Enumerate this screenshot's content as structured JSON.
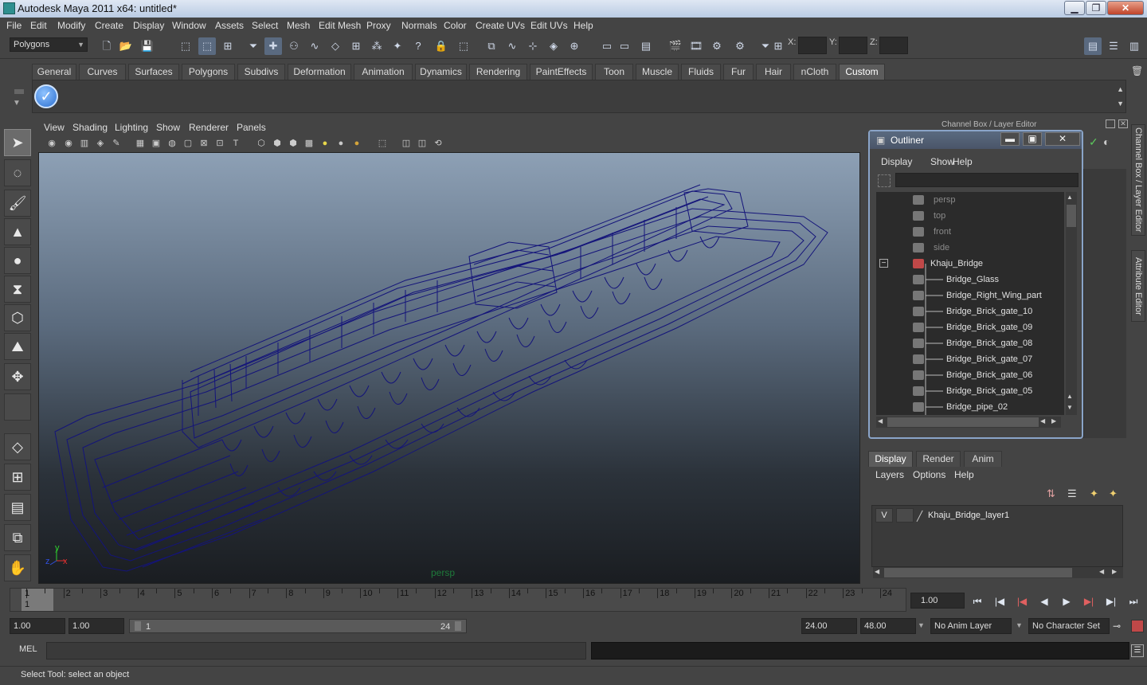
{
  "window": {
    "title": "Autodesk Maya 2011 x64: untitled*",
    "min": "▁",
    "max": "❐",
    "close": "✕"
  },
  "menubar": [
    "File",
    "Edit",
    "Modify",
    "Create",
    "Display",
    "Window",
    "Assets",
    "Select",
    "Mesh",
    "Edit Mesh",
    "Proxy",
    "Normals",
    "Color",
    "Create UVs",
    "Edit UVs",
    "Help"
  ],
  "statusline": {
    "menuset": "Polygons",
    "x_label": "X:",
    "y_label": "Y:",
    "z_label": "Z:"
  },
  "shelf": {
    "tabs": [
      "General",
      "Curves",
      "Surfaces",
      "Polygons",
      "Subdivs",
      "Deformation",
      "Animation",
      "Dynamics",
      "Rendering",
      "PaintEffects",
      "Toon",
      "Muscle",
      "Fluids",
      "Fur",
      "Hair",
      "nCloth",
      "Custom"
    ],
    "active_tab": "Custom",
    "icon_glyph": "✓"
  },
  "viewport": {
    "menu": [
      "View",
      "Shading",
      "Lighting",
      "Show",
      "Renderer",
      "Panels"
    ],
    "camera": "persp",
    "axis_x": "x",
    "axis_y": "y",
    "axis_z": "z"
  },
  "channelbox": {
    "header": "Channel Box / Layer Editor",
    "side_tab_1": "Channel Box / Layer Editor",
    "side_tab_2": "Attribute Editor"
  },
  "outliner": {
    "title": "Outliner",
    "menu": [
      "Display",
      "Show",
      "Help"
    ],
    "btn_min": "▬",
    "btn_max": "▣",
    "btn_close": "✕",
    "items": [
      {
        "label": "persp",
        "kind": "cam"
      },
      {
        "label": "top",
        "kind": "cam"
      },
      {
        "label": "front",
        "kind": "cam"
      },
      {
        "label": "side",
        "kind": "cam"
      },
      {
        "label": "Khaju_Bridge",
        "kind": "group"
      },
      {
        "label": "Bridge_Glass",
        "kind": "mesh"
      },
      {
        "label": "Bridge_Right_Wing_part",
        "kind": "mesh"
      },
      {
        "label": "Bridge_Brick_gate_10",
        "kind": "mesh"
      },
      {
        "label": "Bridge_Brick_gate_09",
        "kind": "mesh"
      },
      {
        "label": "Bridge_Brick_gate_08",
        "kind": "mesh"
      },
      {
        "label": "Bridge_Brick_gate_07",
        "kind": "mesh"
      },
      {
        "label": "Bridge_Brick_gate_06",
        "kind": "mesh"
      },
      {
        "label": "Bridge_Brick_gate_05",
        "kind": "mesh"
      },
      {
        "label": "Bridge_pipe_02",
        "kind": "mesh"
      }
    ],
    "collapse_glyph": "−"
  },
  "layer_editor": {
    "tabs": [
      "Display",
      "Render",
      "Anim"
    ],
    "active_tab": "Display",
    "menu": [
      "Layers",
      "Options",
      "Help"
    ],
    "layer": {
      "visibility": "V",
      "name": "Khaju_Bridge_layer1"
    }
  },
  "timeline": {
    "ticks": [
      "1",
      "2",
      "3",
      "4",
      "5",
      "6",
      "7",
      "8",
      "9",
      "10",
      "11",
      "12",
      "13",
      "14",
      "15",
      "16",
      "17",
      "18",
      "19",
      "20",
      "21",
      "22",
      "23",
      "24"
    ],
    "current_marker": "1",
    "current_frame": "1.00",
    "playback_glyphs": [
      "⏮",
      "|◀",
      "|◀",
      "◀",
      "▶",
      "▶|",
      "▶|",
      "⏭"
    ]
  },
  "range": {
    "start_time": "1.00",
    "playback_start": "1.00",
    "range_start": "1",
    "range_end": "24",
    "playback_end": "24.00",
    "end_time": "48.00",
    "anim_layer": "No Anim Layer",
    "character_set": "No Character Set"
  },
  "command_line": {
    "label": "MEL"
  },
  "help_line": {
    "text": "Select Tool: select an object"
  },
  "colors": {
    "wireframe": "#14147a",
    "background": "#444444",
    "viewport_top": "#8da0b5",
    "viewport_bottom": "#1a1d21",
    "camera_label": "#1e7a3a"
  }
}
